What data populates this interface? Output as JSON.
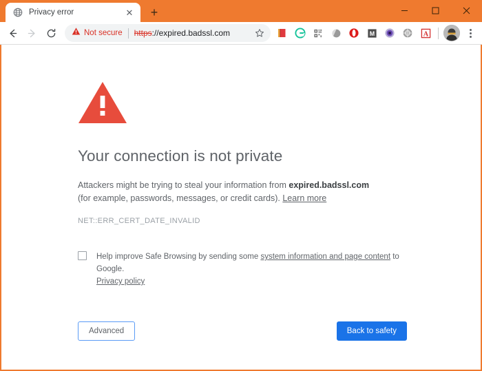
{
  "window": {
    "frame_color": "#ef7a2f",
    "controls": {
      "minimize_label": "–",
      "maximize_label": "□",
      "close_label": "✕"
    }
  },
  "tabstrip": {
    "tabs": [
      {
        "title": "Privacy error",
        "favicon": "globe-icon",
        "close_label": "✕",
        "active": true
      }
    ],
    "new_tab_label": "+"
  },
  "toolbar": {
    "back_icon": "back-arrow-icon",
    "forward_icon": "forward-arrow-icon",
    "reload_icon": "reload-icon",
    "security": {
      "icon": "warning-triangle-icon",
      "label": "Not secure",
      "color": "#d93025"
    },
    "url": {
      "scheme": "https",
      "rest": "://expired.badssl.com",
      "full": "https://expired.badssl.com"
    },
    "bookmark_icon": "star-icon",
    "extensions": [
      {
        "name": "red-book-extension-icon",
        "color": "#e03a3e"
      },
      {
        "name": "grammarly-extension-icon",
        "color": "#15c39a",
        "glyph": "G"
      },
      {
        "name": "qr-grid-extension-icon",
        "color": "#6e6e6e"
      },
      {
        "name": "gray-orb-extension-icon",
        "color": "#8a8a8a"
      },
      {
        "name": "opera-o-extension-icon",
        "color": "#dd1b1b",
        "glyph": "O"
      },
      {
        "name": "mendeley-m-extension-icon",
        "color": "#4c4c4c",
        "glyph": "M"
      },
      {
        "name": "purple-eye-extension-icon",
        "color": "#6c4ab6"
      },
      {
        "name": "gray-globe-extension-icon",
        "color": "#8e8e8e"
      },
      {
        "name": "adobe-acrobat-extension-icon",
        "color": "#d32f2f",
        "glyph": "A"
      }
    ],
    "avatar_name": "profile-avatar",
    "menu_name": "chrome-menu-icon"
  },
  "interstitial": {
    "icon": "red-warning-triangle",
    "icon_color": "#e74c3c",
    "heading": "Your connection is not private",
    "paragraph": {
      "before": "Attackers might be trying to steal your information from ",
      "host": "expired.badssl.com",
      "after": " (for example, passwords, messages, or credit cards). ",
      "learn_more": "Learn more"
    },
    "error_code": "NET::ERR_CERT_DATE_INVALID",
    "optin": {
      "checked": false,
      "before": "Help improve Safe Browsing by sending some ",
      "link": "system information and page content",
      "after": " to Google.",
      "privacy_policy": "Privacy policy"
    },
    "buttons": {
      "advanced": "Advanced",
      "back_to_safety": "Back to safety",
      "primary_color": "#1a73e8"
    }
  }
}
